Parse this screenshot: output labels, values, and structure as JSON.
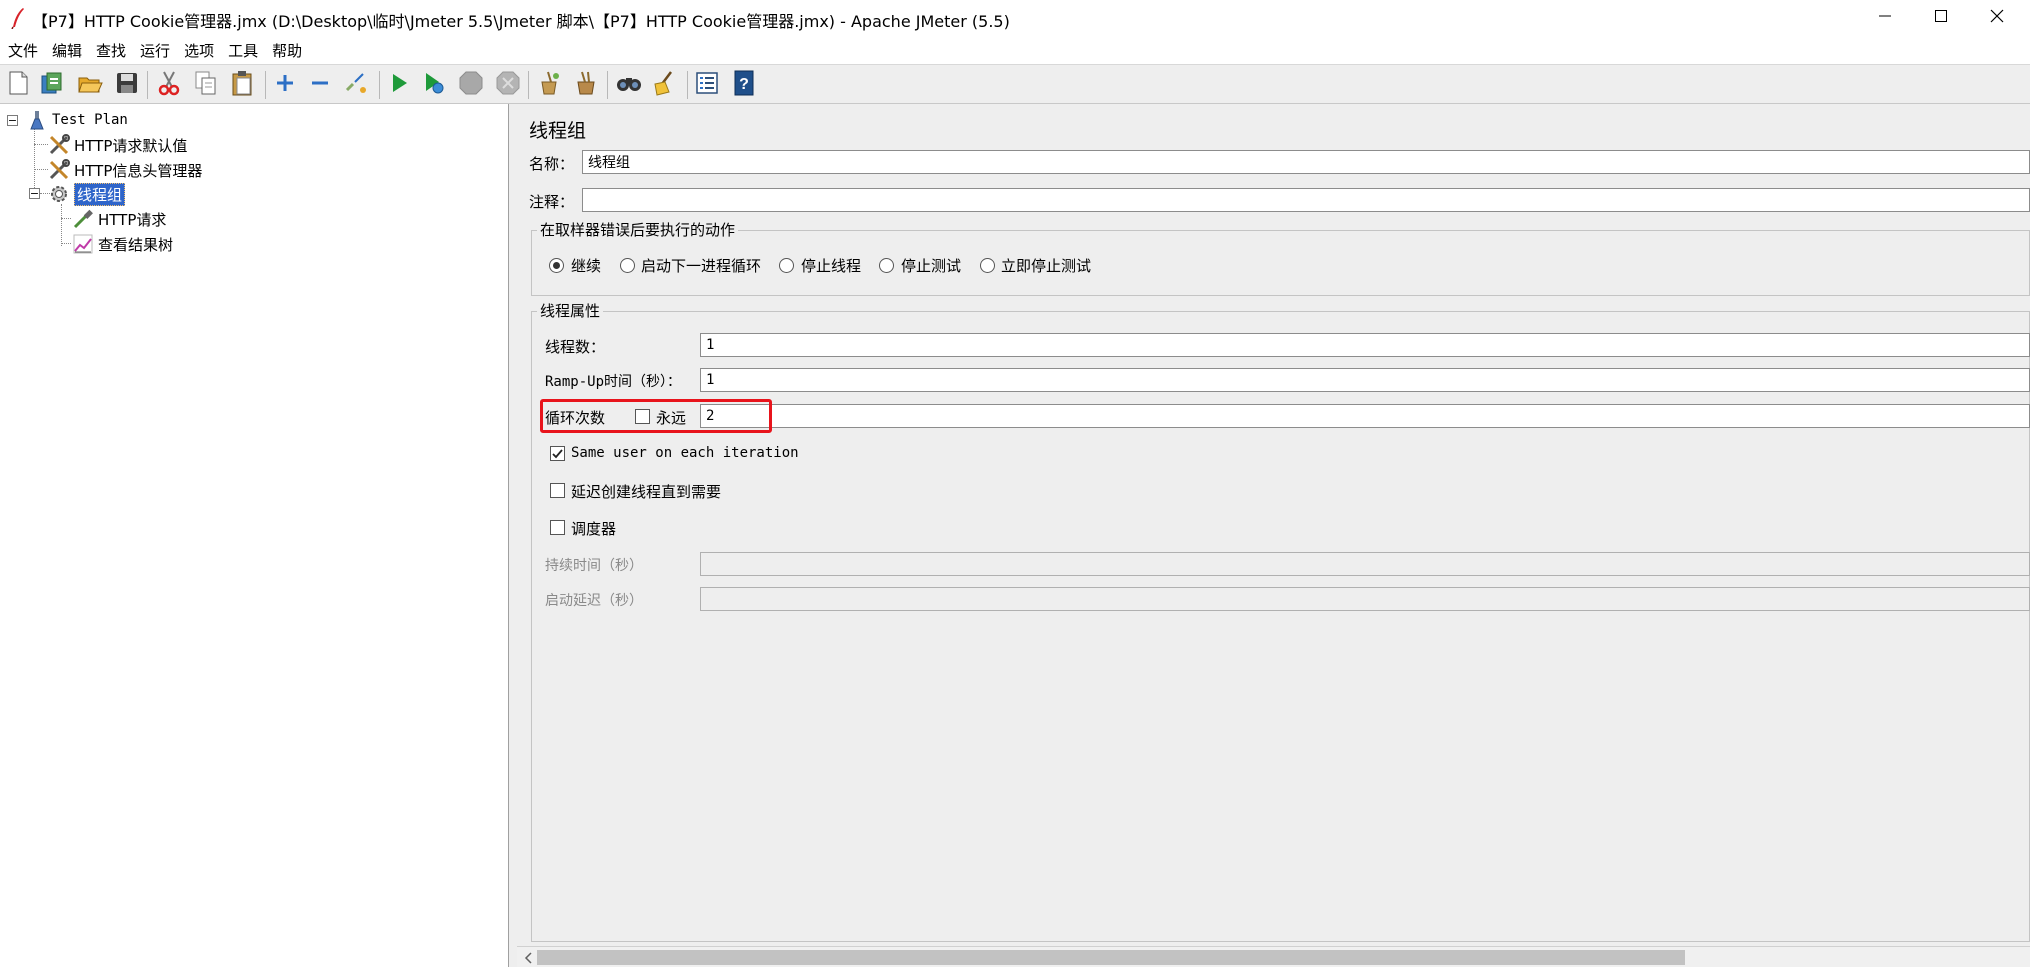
{
  "window": {
    "title": "【P7】HTTP Cookie管理器.jmx (D:\\Desktop\\临时\\Jmeter 5.5\\Jmeter 脚本\\【P7】HTTP Cookie管理器.jmx) - Apache JMeter (5.5)"
  },
  "menu": {
    "items": [
      "文件",
      "编辑",
      "查找",
      "运行",
      "选项",
      "工具",
      "帮助"
    ]
  },
  "toolbar": {
    "icons": [
      "new-icon",
      "templates-icon",
      "open-icon",
      "save-icon",
      "cut-icon",
      "copy-icon",
      "paste-icon",
      "expand-icon",
      "collapse-icon",
      "toggle-icon",
      "start-icon",
      "start-no-pause-icon",
      "stop-icon",
      "shutdown-icon",
      "clear-icon",
      "clear-all-icon",
      "search-icon",
      "reset-search-icon",
      "function-helper-icon",
      "help-icon"
    ]
  },
  "tree": {
    "root": "Test Plan",
    "items": [
      "HTTP请求默认值",
      "HTTP信息头管理器",
      "线程组"
    ],
    "children": [
      "HTTP请求",
      "查看结果树"
    ],
    "selected": "线程组"
  },
  "panel": {
    "heading": "线程组",
    "name_label": "名称：",
    "name_value": "线程组",
    "comment_label": "注释：",
    "comment_value": "",
    "error_action": {
      "title": "在取样器错误后要执行的动作",
      "options": [
        "继续",
        "启动下一进程循环",
        "停止线程",
        "停止测试",
        "立即停止测试"
      ],
      "selected_index": 0
    },
    "thread_props": {
      "title": "线程属性",
      "threads_label": "线程数：",
      "threads_value": "1",
      "rampup_label": "Ramp-Up时间（秒）：",
      "rampup_value": "1",
      "loop_label": "循环次数",
      "forever_label": "永远",
      "forever_checked": false,
      "loop_value": "2",
      "same_user_label": "Same user on each iteration",
      "same_user_checked": true,
      "delay_label": "延迟创建线程直到需要",
      "delay_checked": false,
      "scheduler_label": "调度器",
      "scheduler_checked": false,
      "duration_label": "持续时间（秒）",
      "duration_value": "",
      "startup_delay_label": "启动延迟（秒）",
      "startup_delay_value": ""
    }
  },
  "colors": {
    "selection": "#2f65ca",
    "highlight": "#e8141c",
    "panel_bg": "#eeeeee"
  }
}
